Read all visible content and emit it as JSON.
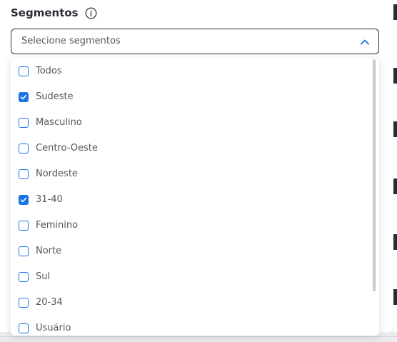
{
  "field": {
    "label": "Segmentos",
    "info_icon": "info-circle-icon"
  },
  "select": {
    "placeholder": "Selecione segmentos",
    "chevron_icon": "chevron-up-icon",
    "expanded": true
  },
  "options": [
    {
      "label": "Todos",
      "checked": false
    },
    {
      "label": "Sudeste",
      "checked": true
    },
    {
      "label": "Masculino",
      "checked": false
    },
    {
      "label": "Centro-Oeste",
      "checked": false
    },
    {
      "label": "Nordeste",
      "checked": false
    },
    {
      "label": "31-40",
      "checked": true
    },
    {
      "label": "Feminino",
      "checked": false
    },
    {
      "label": "Norte",
      "checked": false
    },
    {
      "label": "Sul",
      "checked": false
    },
    {
      "label": "20-34",
      "checked": false
    },
    {
      "label": "Usuário",
      "checked": false
    }
  ],
  "colors": {
    "accent": "#1a73e8",
    "text": "#55555f",
    "label": "#2c2c35",
    "border": "#2f2f38"
  }
}
